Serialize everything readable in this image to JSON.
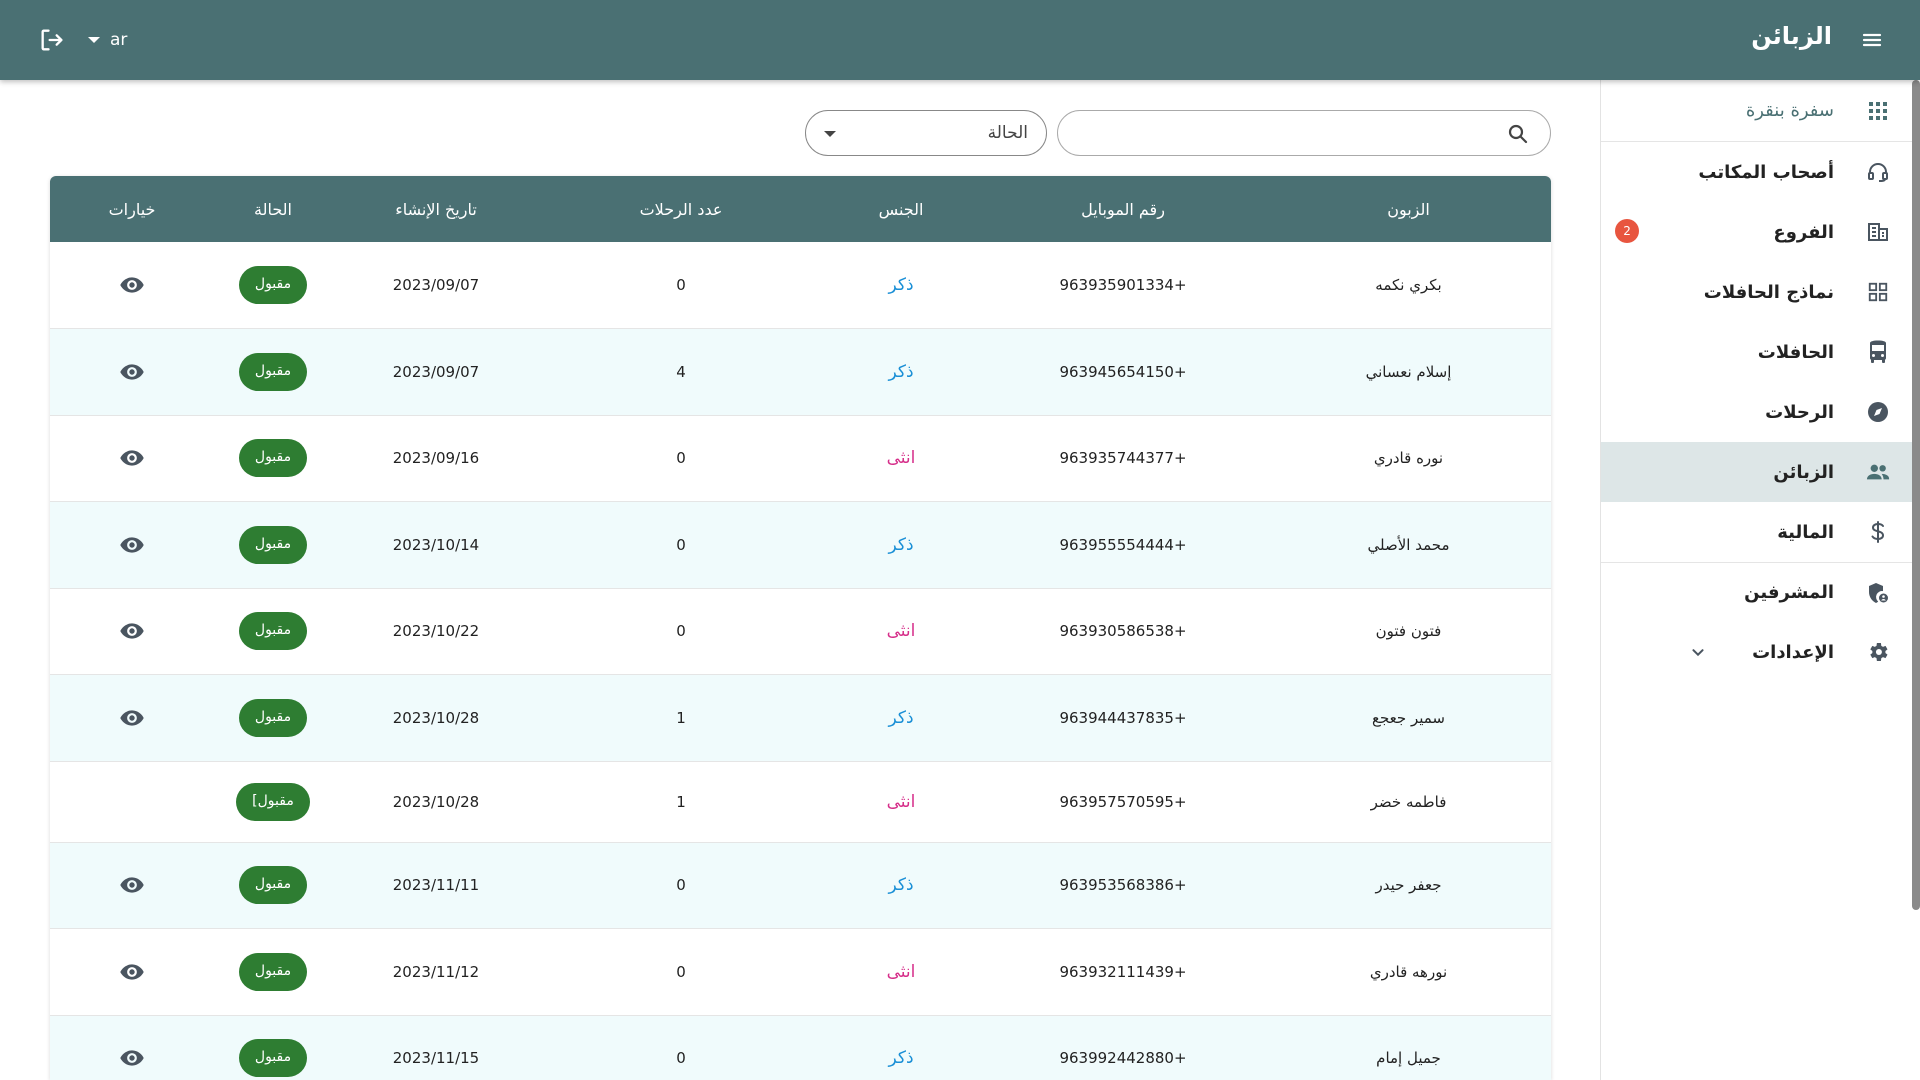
{
  "colors": {
    "primary": "#4a7073",
    "accepted": "#2e7d32",
    "male": "#1a8fd6",
    "female": "#d62f8a",
    "badge": "#e8553f",
    "active_bg": "#dde6e7"
  },
  "header": {
    "title": "الزبائن",
    "language": "ar",
    "menu_icon": "menu-icon",
    "logout_icon": "logout-icon"
  },
  "sidebar": {
    "brand": "سفرة بنقرة",
    "items": [
      {
        "label": "أصحاب المكاتب",
        "icon": "headset-icon"
      },
      {
        "label": "الفروع",
        "icon": "branches-icon",
        "badge": "2"
      },
      {
        "label": "نماذج الحافلات",
        "icon": "grid-icon"
      },
      {
        "label": "الحافلات",
        "icon": "bus-icon"
      },
      {
        "label": "الرحلات",
        "icon": "compass-icon"
      },
      {
        "label": "الزبائن",
        "icon": "people-icon",
        "active": true
      },
      {
        "label": "المالية",
        "icon": "dollar-icon"
      },
      {
        "label": "المشرفين",
        "icon": "admin-shield-icon"
      },
      {
        "label": "الإعدادات",
        "icon": "gear-icon"
      }
    ]
  },
  "filters": {
    "search_placeholder": "",
    "status_label": "الحالة"
  },
  "table": {
    "headers": [
      "الزبون",
      "رقم الموبايل",
      "الجنس",
      "عدد الرحلات",
      "تاريخ الإنشاء",
      "الحالة",
      "خيارات"
    ],
    "rows": [
      {
        "name": "بكري نكمه",
        "phone": "+963935901334",
        "gender": "ذكر",
        "trips": "0",
        "created": "2023/09/07",
        "status": "مقبول"
      },
      {
        "name": "إسلام نعساني",
        "phone": "+963945654150",
        "gender": "ذكر",
        "trips": "4",
        "created": "2023/09/07",
        "status": "مقبول"
      },
      {
        "name": "نوره قادري",
        "phone": "+963935744377",
        "gender": "انثى",
        "trips": "0",
        "created": "2023/09/16",
        "status": "مقبول"
      },
      {
        "name": "محمد الأصلي",
        "phone": "+963955554444",
        "gender": "ذكر",
        "trips": "0",
        "created": "2023/10/14",
        "status": "مقبول"
      },
      {
        "name": "فتون فتون",
        "phone": "+963930586538",
        "gender": "انثى",
        "trips": "0",
        "created": "2023/10/22",
        "status": "مقبول"
      },
      {
        "name": "سمير جعجع",
        "phone": "+963944437835",
        "gender": "ذكر",
        "trips": "1",
        "created": "2023/10/28",
        "status": "مقبول"
      },
      {
        "name": "فاطمه خضر",
        "phone": "+963957570595",
        "gender": "انثى",
        "trips": "1",
        "created": "2023/10/28",
        "status": "مقبول]"
      },
      {
        "name": "جعفر حيدر",
        "phone": "+963953568386",
        "gender": "ذكر",
        "trips": "0",
        "created": "2023/11/11",
        "status": "مقبول"
      },
      {
        "name": "نورهه قادري",
        "phone": "+963932111439",
        "gender": "انثى",
        "trips": "0",
        "created": "2023/11/12",
        "status": "مقبول"
      },
      {
        "name": "جميل إمام",
        "phone": "+963992442880",
        "gender": "ذكر",
        "trips": "0",
        "created": "2023/11/15",
        "status": "مقبول"
      }
    ]
  }
}
